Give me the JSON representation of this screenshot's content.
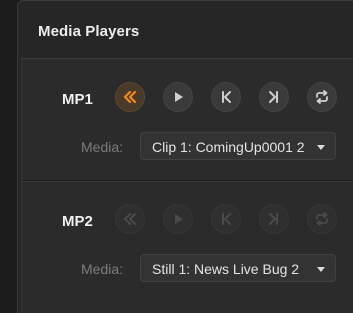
{
  "panel": {
    "title": "Media Players"
  },
  "players": [
    {
      "label": "MP1",
      "media_label": "Media:",
      "media_value": "Clip 1: ComingUp0001 2",
      "buttons": [
        {
          "icon": "rewind-icon",
          "active": true,
          "enabled": true
        },
        {
          "icon": "play-icon",
          "active": false,
          "enabled": true
        },
        {
          "icon": "skip-to-start-icon",
          "active": false,
          "enabled": true
        },
        {
          "icon": "skip-to-end-icon",
          "active": false,
          "enabled": true
        },
        {
          "icon": "loop-icon",
          "active": false,
          "enabled": true
        }
      ]
    },
    {
      "label": "MP2",
      "media_label": "Media:",
      "media_value": "Still 1: News Live Bug 2",
      "buttons": [
        {
          "icon": "rewind-icon",
          "active": false,
          "enabled": false
        },
        {
          "icon": "play-icon",
          "active": false,
          "enabled": false
        },
        {
          "icon": "skip-to-start-icon",
          "active": false,
          "enabled": false
        },
        {
          "icon": "skip-to-end-icon",
          "active": false,
          "enabled": false
        },
        {
          "icon": "loop-icon",
          "active": false,
          "enabled": false
        }
      ]
    }
  ],
  "colors": {
    "accent": "#f28a1e",
    "icon_enabled": "#cfcfcf",
    "icon_disabled": "#4a4a4a"
  }
}
